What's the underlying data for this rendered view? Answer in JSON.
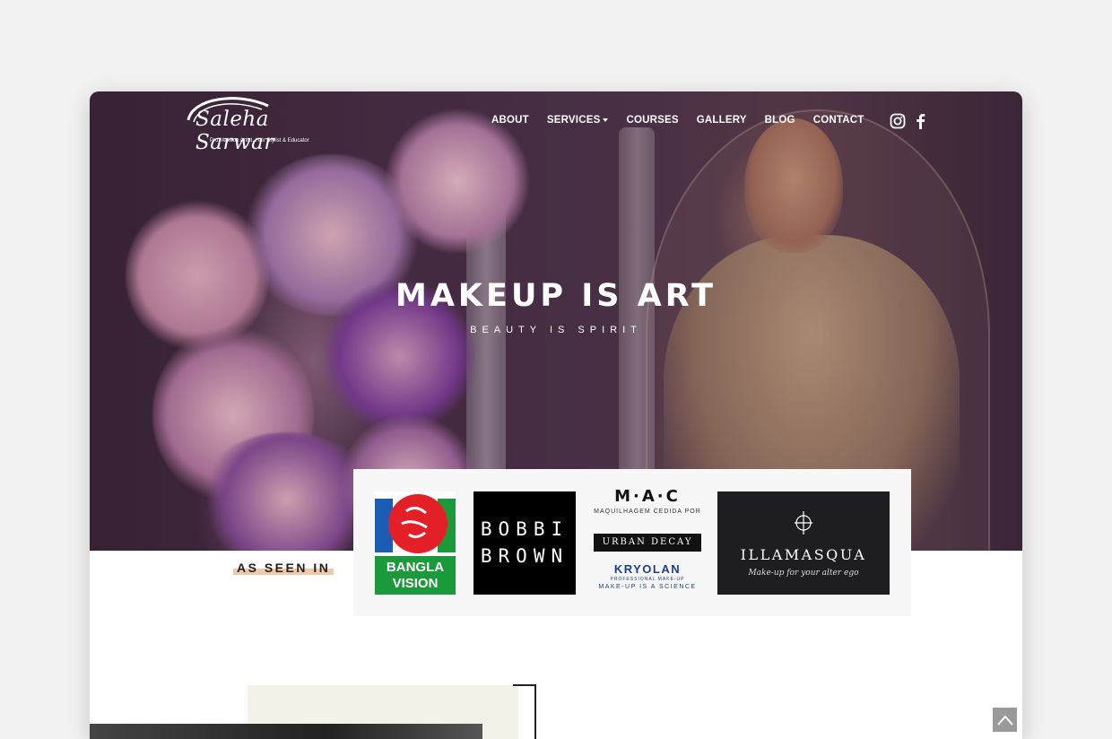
{
  "header": {
    "logo_name": "Saleha Sarwar",
    "logo_tagline": "Pro Makeup Artist, Hair Stylist & Educator",
    "nav": [
      {
        "label": "ABOUT"
      },
      {
        "label": "SERVICES"
      },
      {
        "label": "COURSES"
      },
      {
        "label": "GALLERY"
      },
      {
        "label": "BLOG"
      },
      {
        "label": "CONTACT"
      }
    ],
    "social": [
      "instagram-icon",
      "facebook-icon"
    ]
  },
  "hero": {
    "title": "MAKEUP IS ART",
    "subtitle": "BEAUTY IS SPIRIT"
  },
  "seen_in": {
    "label": "AS SEEN IN",
    "brands": {
      "bangla_vision": {
        "line1": "BANGLA",
        "line2": "VISION"
      },
      "bobbi_brown": {
        "line1": "BOBBI",
        "line2": "BROWN"
      },
      "mac": {
        "logo": "M·A·C",
        "caption": "MAQUILHAGEM CEDIDA POR"
      },
      "urban_decay": {
        "label": "URBAN DECAY"
      },
      "kryolan": {
        "label": "KRYOLAN",
        "sub": "PROFESSIONAL MAKE-UP",
        "tagline": "MAKE-UP IS A SCIENCE"
      },
      "illamasqua": {
        "label": "ILLAMASQUA",
        "tagline": "Make-up for your alter ego"
      }
    }
  },
  "colors": {
    "accent_underline": "#f0c9a8",
    "bangla_red": "#e32027",
    "bangla_green": "#1a9a3a",
    "bangla_blue": "#1c5cb5",
    "kryolan_blue": "#1b3f8f"
  },
  "scroll_top_icon": "chevron-up-icon"
}
